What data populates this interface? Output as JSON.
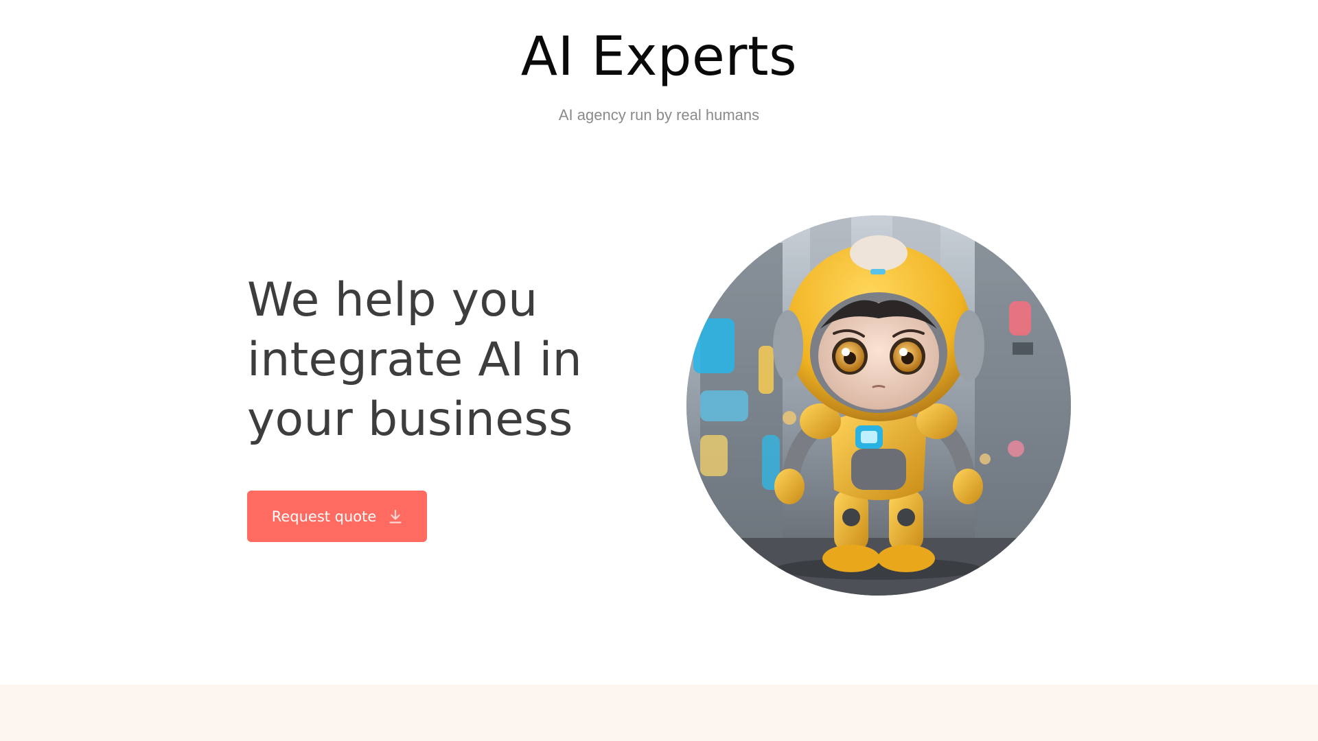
{
  "header": {
    "title": "AI Experts",
    "tagline": "AI agency run by real humans"
  },
  "hero": {
    "heading_lines": [
      "We help you",
      "integrate AI in",
      "your business"
    ],
    "cta_label": "Request quote",
    "cta_icon": "download-icon",
    "image_subject": "robot-illustration"
  },
  "colors": {
    "accent": "#ff6b61",
    "heading": "#3d3d3d",
    "title": "#0a0a0a",
    "tagline": "#8a8a8a",
    "footer_band": "#fdf5f0"
  }
}
